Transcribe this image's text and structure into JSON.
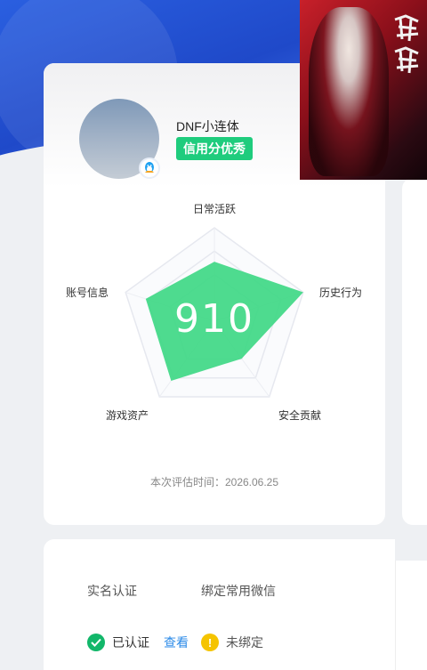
{
  "profile": {
    "username": "DNF小连体",
    "credit_badge": "信用分优秀"
  },
  "score": {
    "value": "910",
    "eval_time": "本次评估时间：2026.06.25"
  },
  "radar": {
    "dimensions": [
      "日常活跃",
      "历史行为",
      "安全贡献",
      "游戏资产",
      "账号信息"
    ],
    "values": [
      0.28,
      1.0,
      0.0,
      0.58,
      0.55
    ],
    "fill_color": "#3fd886"
  },
  "verification": {
    "realname": {
      "title": "实名认证",
      "status": "已认证",
      "action": "查看",
      "color": "#12b76a"
    },
    "wechat": {
      "title": "绑定常用微信",
      "status": "未绑定",
      "color": "#f5c400"
    }
  },
  "icons": {
    "qq": "qq-penguin-icon",
    "verified": "check-circle-icon",
    "warning": "warning-circle-icon"
  }
}
